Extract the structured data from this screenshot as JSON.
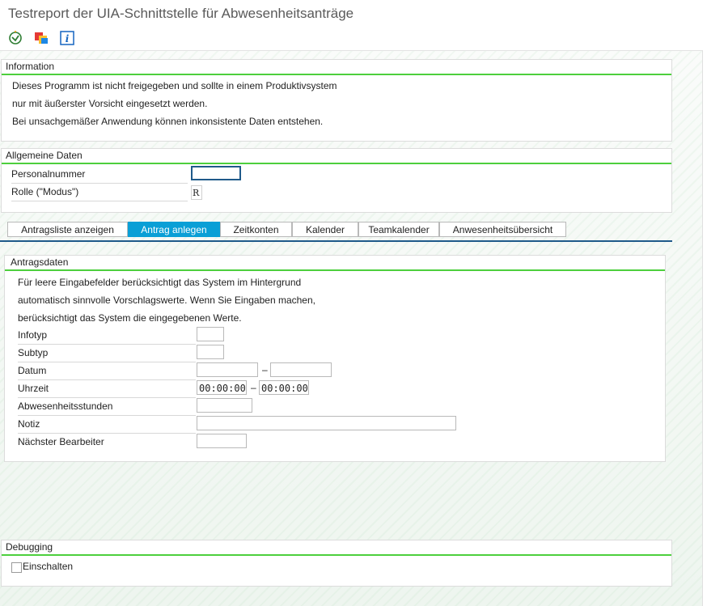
{
  "window": {
    "title": "Testreport der UIA-Schnittstelle für Abwesenheitsanträge"
  },
  "toolbar": {
    "buttons": [
      {
        "icon": "execute-icon"
      },
      {
        "icon": "variants-icon"
      },
      {
        "icon": "info-icon"
      }
    ]
  },
  "information": {
    "title": "Information",
    "lines": [
      "Dieses Programm ist nicht freigegeben und sollte in einem Produktivsystem",
      "nur mit äußerster Vorsicht eingesetzt werden.",
      "Bei unsachgemäßer Anwendung können inkonsistente Daten entstehen."
    ]
  },
  "general": {
    "title": "Allgemeine Daten",
    "personal_label": "Personalnummer",
    "personal_value": "",
    "role_label": "Rolle (\"Modus\")",
    "role_value": "R"
  },
  "tabs": [
    {
      "label": "Antragsliste anzeigen",
      "active": false
    },
    {
      "label": "Antrag anlegen",
      "active": true
    },
    {
      "label": "Zeitkonten",
      "active": false
    },
    {
      "label": "Kalender",
      "active": false
    },
    {
      "label": "Teamkalender",
      "active": false
    },
    {
      "label": "Anwesenheitsübersicht",
      "active": false
    }
  ],
  "request": {
    "title": "Antragsdaten",
    "hint_lines": [
      "Für leere Eingabefelder berücksichtigt das System im Hintergrund",
      "automatisch sinnvolle Vorschlagswerte. Wenn Sie Eingaben machen,",
      "berücksichtigt das System die eingegebenen Werte."
    ],
    "fields": {
      "infotyp": {
        "label": "Infotyp",
        "value": ""
      },
      "subtyp": {
        "label": "Subtyp",
        "value": ""
      },
      "datum": {
        "label": "Datum",
        "from": "",
        "separator": "–",
        "to": ""
      },
      "uhrzeit": {
        "label": "Uhrzeit",
        "from": "00:00:00",
        "separator": "–",
        "to": "00:00:00"
      },
      "stunden": {
        "label": "Abwesenheitsstunden",
        "value": ""
      },
      "notiz": {
        "label": "Notiz",
        "value": ""
      },
      "bearbeiter": {
        "label": "Nächster Bearbeiter",
        "value": ""
      }
    }
  },
  "debugging": {
    "title": "Debugging",
    "checkbox_label": "Einschalten",
    "checked": false
  },
  "colors": {
    "accent_green": "#4dcf3d",
    "tab_active": "#0a9fd6",
    "tab_underline": "#1f5a8a"
  }
}
